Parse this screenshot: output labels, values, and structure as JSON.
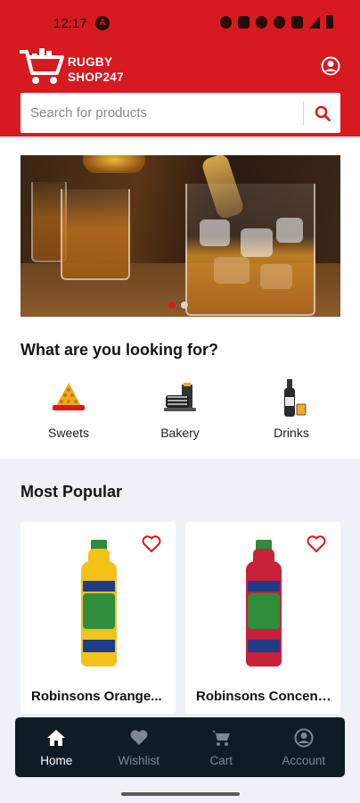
{
  "status_bar": {
    "time": "12:17",
    "badge_letter": "A"
  },
  "header": {
    "brand_line1": "RUGBY",
    "brand_line2": "SHOP247",
    "accent_color": "#d71920"
  },
  "search": {
    "placeholder": "Search for products"
  },
  "banner": {
    "slide_count": 2,
    "active_slide": 1
  },
  "categories_section": {
    "title": "What are you looking for?",
    "items": [
      {
        "label": "Sweets",
        "icon": "sweets-icon"
      },
      {
        "label": "Bakery",
        "icon": "bakery-icon"
      },
      {
        "label": "Drinks",
        "icon": "drinks-icon"
      }
    ]
  },
  "popular_section": {
    "title": "Most Popular",
    "products": [
      {
        "name": "Robinsons Orange...",
        "bottle_color": "#f2c21b"
      },
      {
        "name": "Robinsons Concent...",
        "bottle_color": "#c8213a"
      }
    ]
  },
  "bottom_nav": {
    "items": [
      {
        "label": "Home",
        "icon": "home-icon",
        "active": true
      },
      {
        "label": "Wishlist",
        "icon": "heart-icon",
        "active": false
      },
      {
        "label": "Cart",
        "icon": "cart-icon",
        "active": false
      },
      {
        "label": "Account",
        "icon": "account-icon",
        "active": false
      }
    ]
  }
}
